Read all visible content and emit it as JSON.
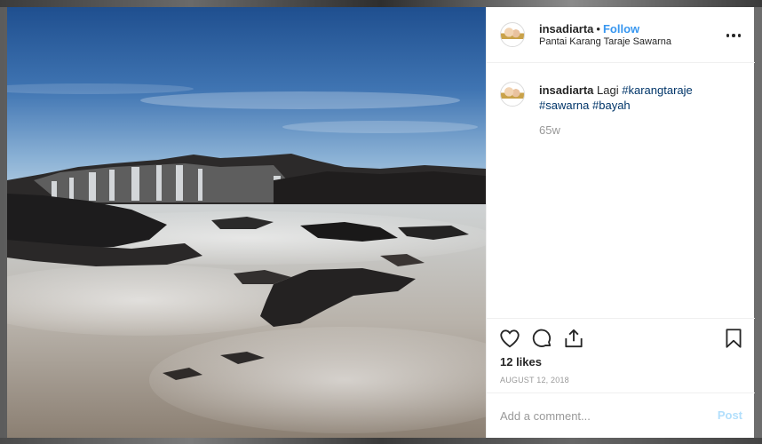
{
  "post": {
    "username": "insadiarta",
    "separator": "•",
    "follow_label": "Follow",
    "location": "Pantai Karang Taraje Sawarna",
    "caption": {
      "username": "insadiarta",
      "text": "Lagi",
      "hashtags": [
        "#karangtaraje",
        "#sawarna",
        "#bayah"
      ]
    },
    "time_ago": "65w",
    "likes": "12 likes",
    "date": "AUGUST 12, 2018"
  },
  "comment": {
    "placeholder": "Add a comment...",
    "post_label": "Post"
  },
  "icons": {
    "more": "more-options-icon",
    "like": "heart-icon",
    "comment": "comment-bubble-icon",
    "share": "share-icon",
    "save": "bookmark-icon"
  },
  "colors": {
    "link": "#3897f0",
    "hashtag": "#003569",
    "muted": "#999999",
    "post_disabled": "#b2dffc"
  }
}
